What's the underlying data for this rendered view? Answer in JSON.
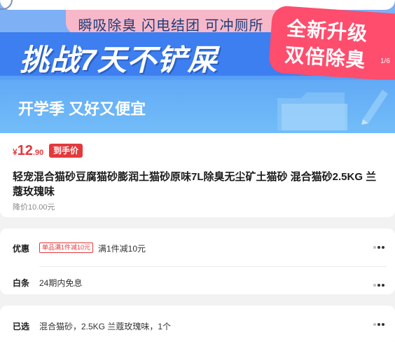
{
  "banner": {
    "tagline": "瞬吸除臭 闪电结团 可冲厕所",
    "headline": "挑战7天不铲屎",
    "badge_line1": "全新升级",
    "badge_line2": "双倍除臭",
    "page_indicator": "1/6",
    "subtitle": "开学季 又好又便宜"
  },
  "product": {
    "currency": "¥",
    "price_int": "12",
    "price_dec": ".90",
    "net_price_tag": "到手价",
    "title": "轻宠混合猫砂豆腐猫砂膨润土猫砂原味7L除臭无尘矿土猫砂 混合猫砂2.5KG 兰蔻玫瑰味",
    "original_price": "降价10.00元"
  },
  "promo": {
    "label": "优惠",
    "coupon_tag": "单品满1件减10元",
    "coupon_text": "满1件减10元",
    "baitiao_label": "白条",
    "baitiao_text": "24期内免息"
  },
  "selected": {
    "label": "已选",
    "text": "混合猫砂，2.5KG 兰蔻玫瑰味，1个"
  },
  "colors": {
    "accent_red": "#e4393c",
    "banner_blue": "#3d7ef0",
    "badge_pink": "#ff4d6d"
  }
}
